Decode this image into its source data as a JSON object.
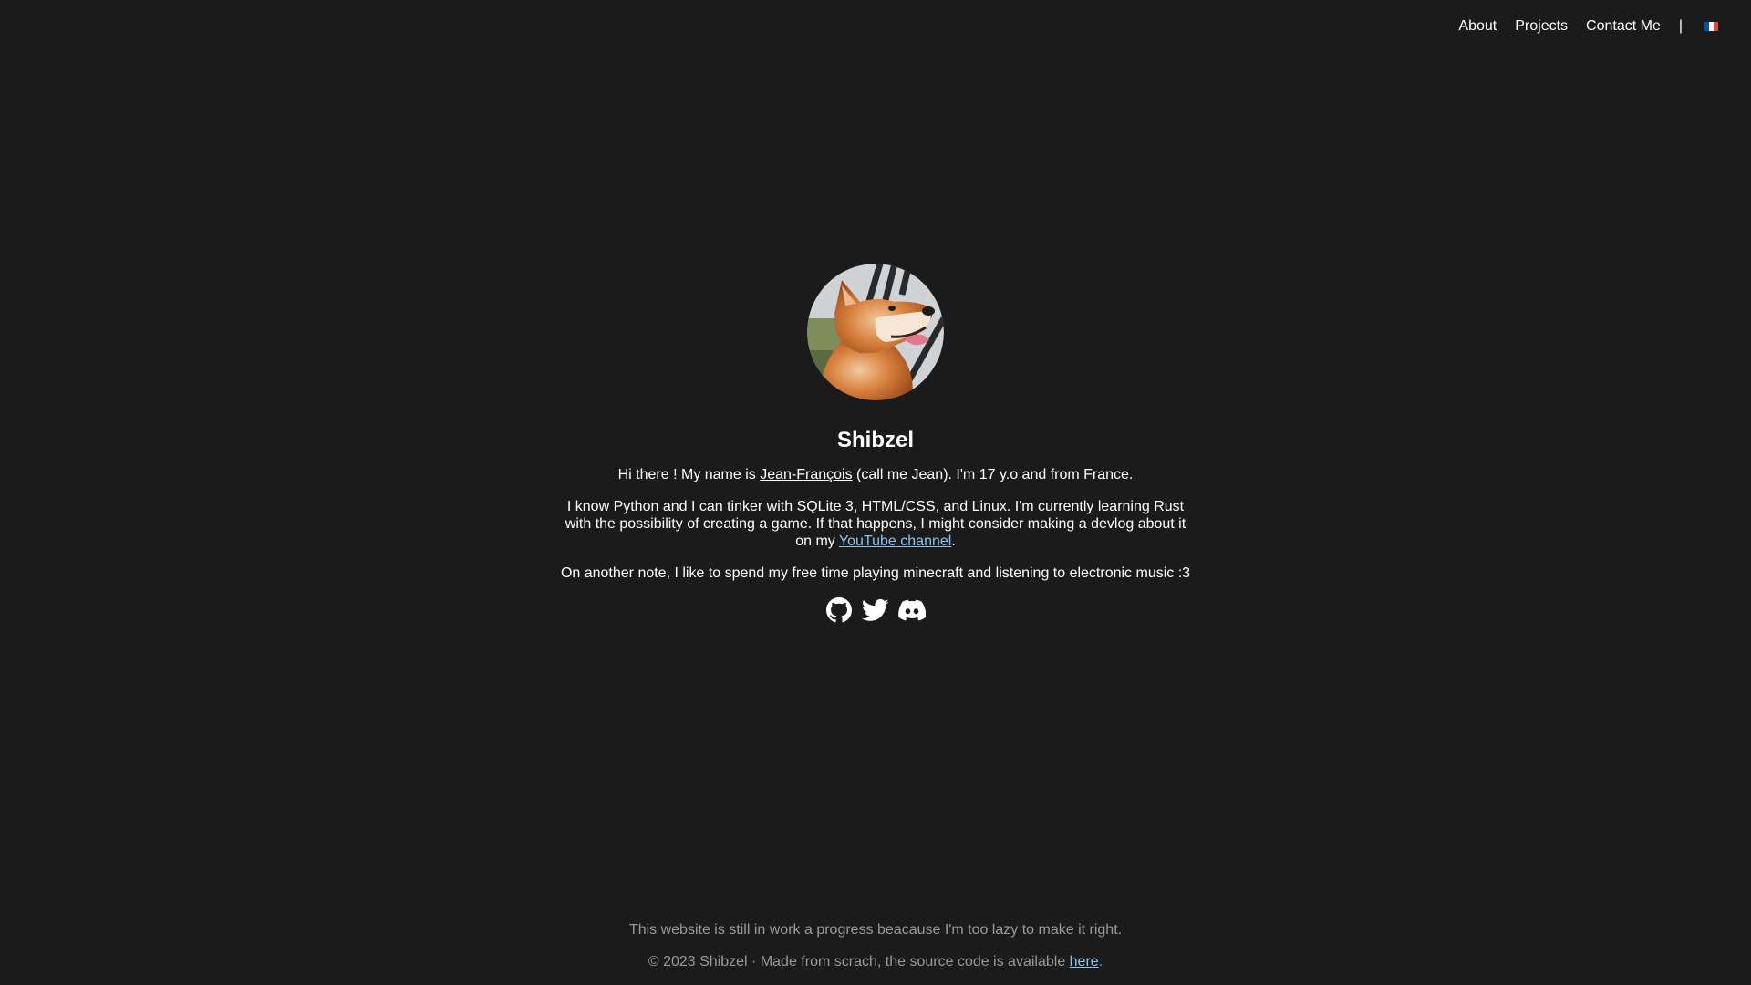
{
  "nav": {
    "about": "About",
    "projects": "Projects",
    "contact": "Contact Me",
    "separator": "|",
    "language_flag": "flag-france-icon",
    "flag_colors": [
      "#0055a4",
      "#ffffff",
      "#ef4135"
    ]
  },
  "profile": {
    "avatar": "shiba-inu-avatar",
    "name": "Shibzel",
    "intro_before": "Hi there ! My name is ",
    "intro_link": "Jean-François",
    "intro_after": " (call me Jean). I'm 17 y.o and from France.",
    "skills_before": "I know Python and I can tinker with SQLite 3, HTML/CSS, and Linux. I'm currently learning Rust with the possibility of creating a game. If that happens, I might consider making a devlog about it on my ",
    "skills_link": "YouTube channel",
    "skills_after": ".",
    "hobbies": "On another note, I like to spend my free time playing minecraft and listening to electronic music :3"
  },
  "socials": [
    {
      "icon": "github-icon"
    },
    {
      "icon": "twitter-icon"
    },
    {
      "icon": "discord-icon"
    }
  ],
  "footer": {
    "notice": "This website is still in work a progress beacause I'm too lazy to make it right.",
    "copyright_before": "© 2023 Shibzel · Made from scrach, the source code is available ",
    "source_link": "here",
    "copyright_after": "."
  },
  "colors": {
    "background": "#1b1b1b",
    "text": "#ffffff",
    "muted_text": "#9a9a9a",
    "link_accent": "#8ec5ee"
  }
}
